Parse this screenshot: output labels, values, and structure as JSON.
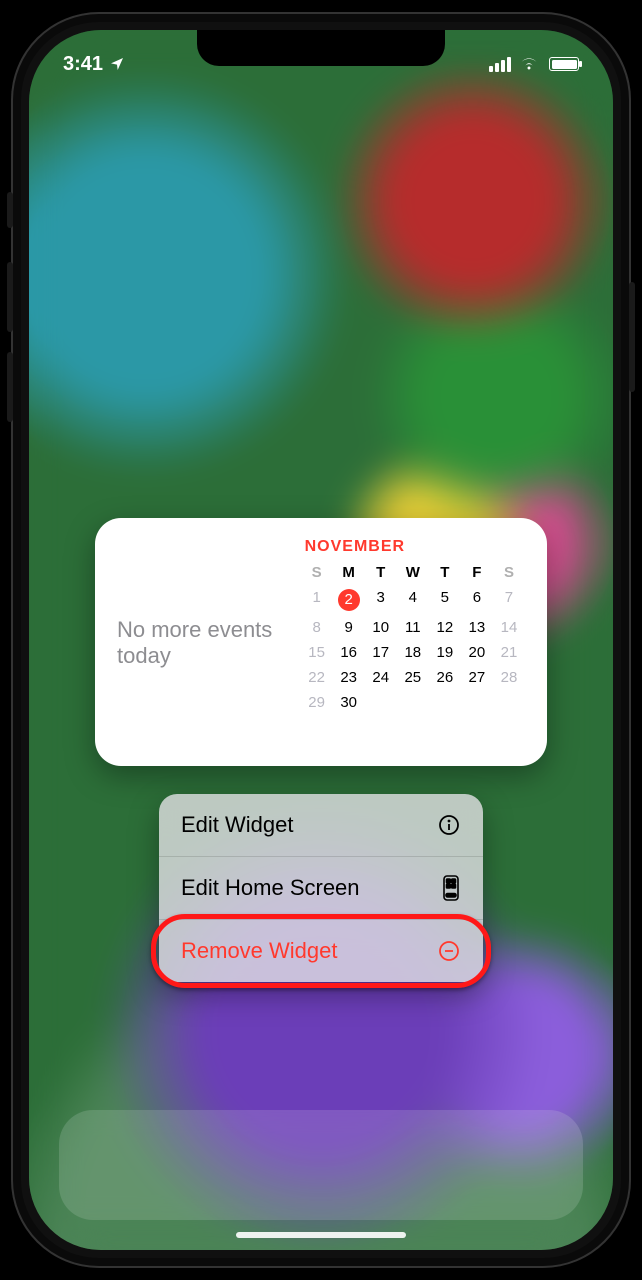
{
  "status_bar": {
    "time": "3:41",
    "location_on": true
  },
  "calendar_widget": {
    "events_text": "No more events today",
    "month_label": "NOVEMBER",
    "dow": [
      "S",
      "M",
      "T",
      "W",
      "T",
      "F",
      "S"
    ],
    "days": [
      {
        "n": 1,
        "weekend": true
      },
      {
        "n": 2,
        "today": true
      },
      {
        "n": 3
      },
      {
        "n": 4
      },
      {
        "n": 5
      },
      {
        "n": 6
      },
      {
        "n": 7,
        "weekend": true
      },
      {
        "n": 8,
        "weekend": true
      },
      {
        "n": 9
      },
      {
        "n": 10
      },
      {
        "n": 11
      },
      {
        "n": 12
      },
      {
        "n": 13
      },
      {
        "n": 14,
        "weekend": true
      },
      {
        "n": 15,
        "weekend": true
      },
      {
        "n": 16
      },
      {
        "n": 17
      },
      {
        "n": 18
      },
      {
        "n": 19
      },
      {
        "n": 20
      },
      {
        "n": 21,
        "weekend": true
      },
      {
        "n": 22,
        "weekend": true
      },
      {
        "n": 23
      },
      {
        "n": 24
      },
      {
        "n": 25
      },
      {
        "n": 26
      },
      {
        "n": 27
      },
      {
        "n": 28,
        "weekend": true
      },
      {
        "n": 29,
        "weekend": true
      },
      {
        "n": 30
      }
    ]
  },
  "context_menu": {
    "items": [
      {
        "label": "Edit Widget",
        "icon": "info-circle-icon"
      },
      {
        "label": "Edit Home Screen",
        "icon": "homescreen-icon"
      },
      {
        "label": "Remove Widget",
        "icon": "minus-circle-icon",
        "destructive": true
      }
    ]
  },
  "annotation": {
    "highlight_index": 2
  }
}
